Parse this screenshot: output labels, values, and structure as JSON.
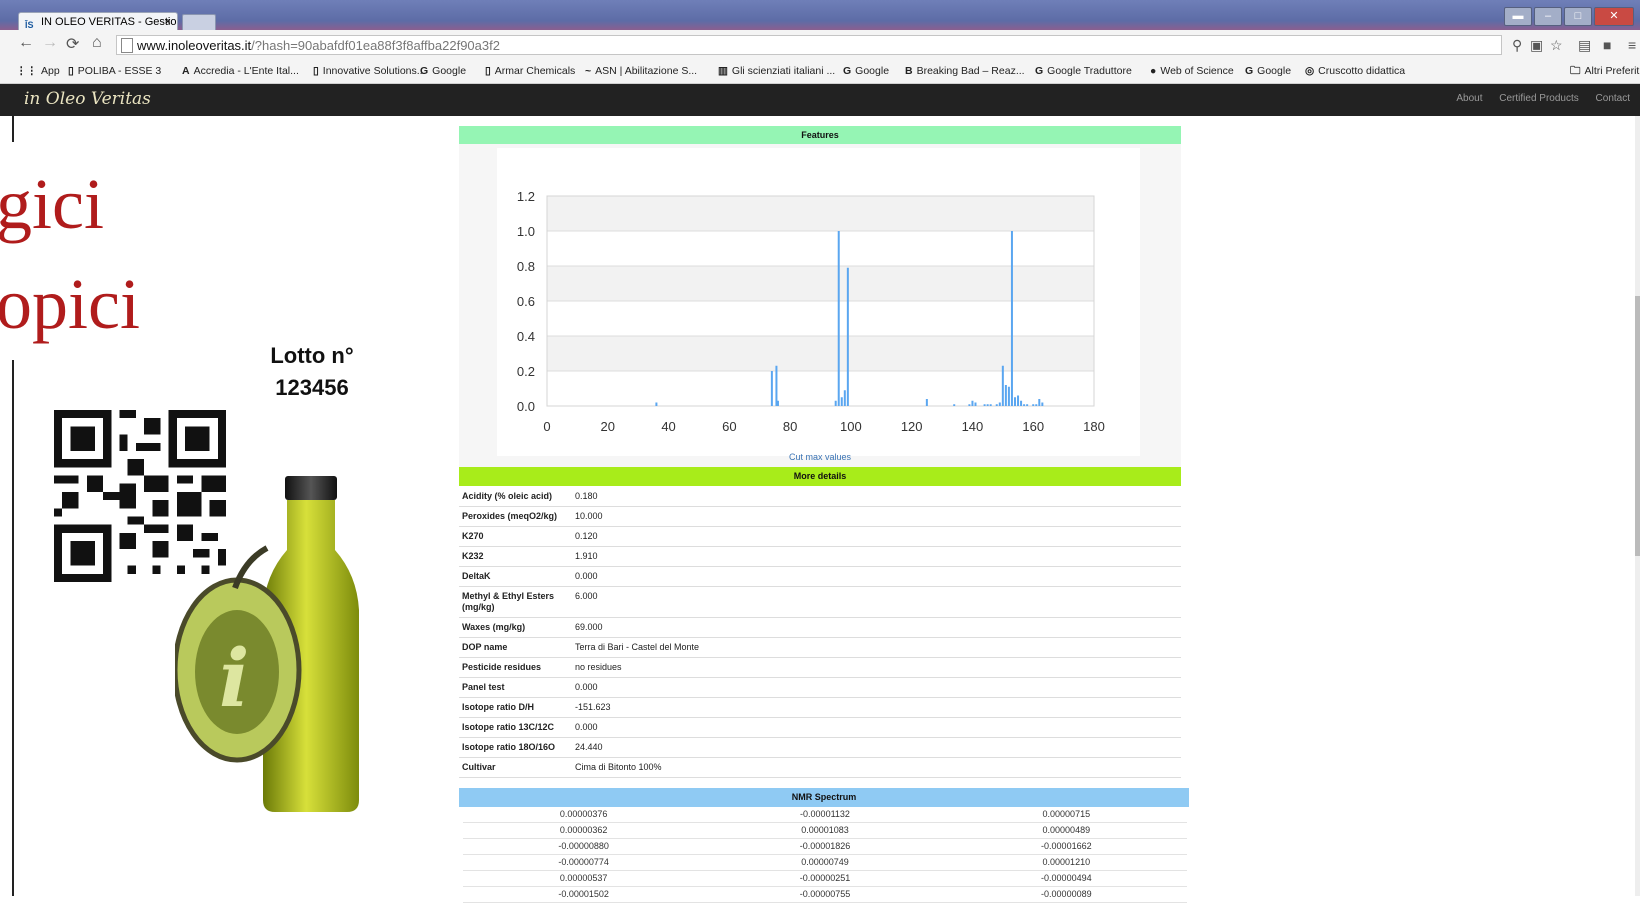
{
  "browser": {
    "tab_title": "IN OLEO VERITAS - Gestio",
    "tab_close": "×",
    "url_host": "www.inoleoveritas.it",
    "url_path": "/?hash=90abafdf01ea88f3f8affba22f90a3f2",
    "bookmarks": [
      {
        "label": "App"
      },
      {
        "label": "POLIBA - ESSE 3"
      },
      {
        "label": "Accredia - L'Ente Ital..."
      },
      {
        "label": "Innovative Solutions..."
      },
      {
        "label": "Google"
      },
      {
        "label": "Armar Chemicals"
      },
      {
        "label": "ASN | Abilitazione S..."
      },
      {
        "label": "Gli scienziati italiani ..."
      },
      {
        "label": "Google"
      },
      {
        "label": "Breaking Bad – Reaz..."
      },
      {
        "label": "Google Traduttore"
      },
      {
        "label": "Web of Science"
      },
      {
        "label": "Google"
      },
      {
        "label": "Cruscotto didattica"
      }
    ],
    "other_bookmarks": "Altri Preferiti"
  },
  "site": {
    "logo": "in Oleo Veritas",
    "nav": [
      "About",
      "Certified Products",
      "Contact"
    ]
  },
  "slide": {
    "line1": "gici",
    "line2": "opici",
    "lotto_line1": "Lotto n°",
    "lotto_line2": "123456",
    "colors": {
      "text": "#b01c1c"
    }
  },
  "features": {
    "header": "Features",
    "header_color": "#95f5b4",
    "cut_link": "Cut max values"
  },
  "chart_data": {
    "type": "bar",
    "xlim": [
      0,
      180
    ],
    "ylim": [
      0,
      1.2
    ],
    "xticks": [
      0,
      20,
      40,
      60,
      80,
      100,
      120,
      140,
      160,
      180
    ],
    "yticks": [
      "0.0",
      "0.2",
      "0.4",
      "0.6",
      "0.8",
      "1.0",
      "1.2"
    ],
    "bar_color": "#5aa6f0",
    "grid_bands": true,
    "x": [
      36,
      74,
      75.5,
      76,
      95,
      96,
      97,
      98,
      99,
      125,
      134,
      139,
      140,
      141,
      144,
      145,
      146,
      148,
      149,
      150,
      151,
      152,
      153,
      154,
      155,
      156,
      157,
      158,
      160,
      161,
      162,
      163
    ],
    "values": [
      0.02,
      0.2,
      0.23,
      0.03,
      0.03,
      1.0,
      0.05,
      0.09,
      0.79,
      0.04,
      0.01,
      0.01,
      0.03,
      0.02,
      0.01,
      0.01,
      0.01,
      0.01,
      0.02,
      0.23,
      0.12,
      0.11,
      1.0,
      0.05,
      0.06,
      0.03,
      0.01,
      0.01,
      0.01,
      0.01,
      0.04,
      0.02
    ]
  },
  "details": {
    "header": "More details",
    "header_color": "#a8ec1a",
    "rows": [
      {
        "key": "Acidity (% oleic acid)",
        "value": "0.180"
      },
      {
        "key": "Peroxides (meqO2/kg)",
        "value": "10.000"
      },
      {
        "key": "K270",
        "value": "0.120"
      },
      {
        "key": "K232",
        "value": "1.910"
      },
      {
        "key": "DeltaK",
        "value": "0.000"
      },
      {
        "key": "Methyl & Ethyl Esters (mg/kg)",
        "value": "6.000"
      },
      {
        "key": "Waxes (mg/kg)",
        "value": "69.000"
      },
      {
        "key": "DOP name",
        "value": "Terra di Bari - Castel del Monte"
      },
      {
        "key": "Pesticide residues",
        "value": "no residues"
      },
      {
        "key": "Panel test",
        "value": "0.000"
      },
      {
        "key": "Isotope ratio D/H",
        "value": "-151.623"
      },
      {
        "key": "Isotope ratio 13C/12C",
        "value": "0.000"
      },
      {
        "key": "Isotope ratio 18O/16O",
        "value": "24.440"
      },
      {
        "key": "Cultivar",
        "value": "Cima di Bitonto 100%"
      }
    ]
  },
  "nmr": {
    "header": "NMR Spectrum",
    "header_color": "#8fcaf3",
    "rows": [
      [
        "0.00000376",
        "-0.00001132",
        "0.00000715"
      ],
      [
        "0.00000362",
        "0.00001083",
        "0.00000489"
      ],
      [
        "-0.00000880",
        "-0.00001826",
        "-0.00001662"
      ],
      [
        "-0.00000774",
        "0.00000749",
        "0.00001210"
      ],
      [
        "0.00000537",
        "-0.00000251",
        "-0.00000494"
      ],
      [
        "-0.00001502",
        "-0.00000755",
        "-0.00000089"
      ]
    ]
  }
}
